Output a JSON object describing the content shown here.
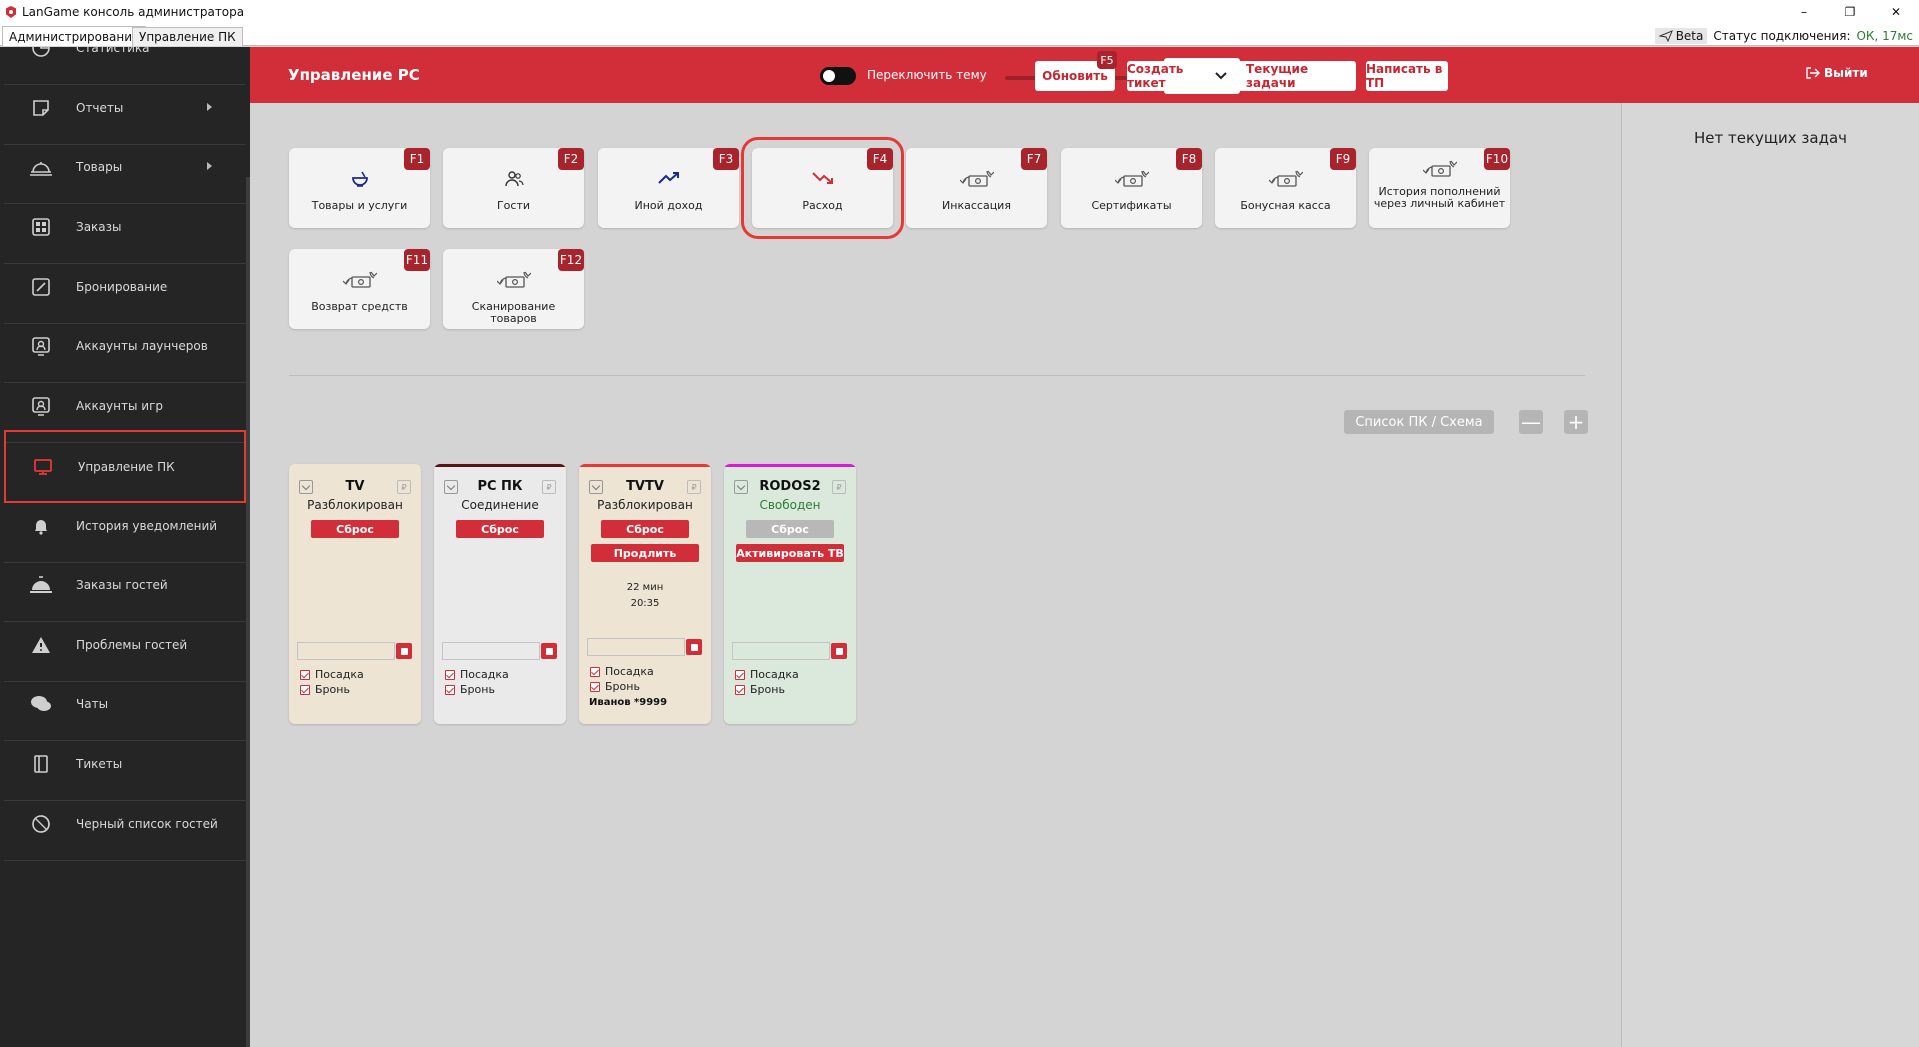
{
  "window": {
    "title": "LanGame консоль администратора",
    "controls": {
      "minimize": "–",
      "maximize": "❐",
      "close": "✕"
    }
  },
  "app_tabs": [
    {
      "label": "Администрирование",
      "active": true
    },
    {
      "label": "Управление ПК",
      "active": false
    }
  ],
  "status": {
    "beta": "Beta",
    "connection_label": "Статус подключения:",
    "connection_value": "ОК, 17мс"
  },
  "sidebar": {
    "items": [
      {
        "label": "Статистика",
        "icon": "chart-pie-icon",
        "submenu": false,
        "active": false
      },
      {
        "label": "Отчеты",
        "icon": "document-icon",
        "submenu": true,
        "active": false
      },
      {
        "label": "Товары",
        "icon": "cloche-icon",
        "submenu": true,
        "active": false
      },
      {
        "label": "Заказы",
        "icon": "grid-icon",
        "submenu": false,
        "active": false
      },
      {
        "label": "Бронирование",
        "icon": "edit-icon",
        "submenu": false,
        "active": false
      },
      {
        "label": "Аккаунты лаунчеров",
        "icon": "account-card-icon",
        "submenu": false,
        "active": false
      },
      {
        "label": "Аккаунты игр",
        "icon": "account-card-icon",
        "submenu": false,
        "active": false
      },
      {
        "label": "Управление ПК",
        "icon": "monitor-icon",
        "submenu": false,
        "active": true
      },
      {
        "label": "История уведомлений",
        "icon": "bell-icon",
        "submenu": false,
        "active": false
      },
      {
        "label": "Заказы гостей",
        "icon": "service-bell-icon",
        "submenu": false,
        "active": false
      },
      {
        "label": "Проблемы гостей",
        "icon": "warning-icon",
        "submenu": false,
        "active": false
      },
      {
        "label": "Чаты",
        "icon": "chat-icon",
        "submenu": false,
        "active": false
      },
      {
        "label": "Тикеты",
        "icon": "ticket-icon",
        "submenu": false,
        "active": false
      },
      {
        "label": "Черный список гостей",
        "icon": "blacklist-icon",
        "submenu": false,
        "active": false
      }
    ]
  },
  "header": {
    "title": "Управление PC",
    "theme_toggle_label": "Переключить тему",
    "language": "ru",
    "refresh_label": "Обновить",
    "refresh_key": "F5",
    "create_ticket_label": "Создать тикет",
    "current_tasks_label": "Текущие задачи",
    "write_support_label": "Написать в ТП",
    "logout_label": "Выйти"
  },
  "tasks_panel": {
    "empty_text": "Нет текущих задач"
  },
  "actions": [
    {
      "label": "Товары и услуги",
      "key": "F1",
      "icon": "bowl-icon"
    },
    {
      "label": "Гости",
      "key": "F2",
      "icon": "users-icon"
    },
    {
      "label": "Иной доход",
      "key": "F3",
      "icon": "trend-up-icon"
    },
    {
      "label": "Расход",
      "key": "F4",
      "icon": "trend-down-icon"
    },
    {
      "label": "Инкассация",
      "key": "F7",
      "icon": "money-exchange-icon"
    },
    {
      "label": "Сертификаты",
      "key": "F8",
      "icon": "money-exchange-icon"
    },
    {
      "label": "Бонусная касса",
      "key": "F9",
      "icon": "money-exchange-icon"
    },
    {
      "label": "История пополнений через личный кабинет",
      "key": "F10",
      "icon": "money-exchange-icon"
    },
    {
      "label": "Возврат средств",
      "key": "F11",
      "icon": "money-exchange-icon"
    },
    {
      "label": "Сканирование товаров",
      "key": "F12",
      "icon": "money-exchange-icon"
    }
  ],
  "pc_list": {
    "view_toggle_label": "Список ПК / Схема",
    "zoom_out": "—",
    "zoom_in": "+"
  },
  "pcs": [
    {
      "name": "TV",
      "state": "Разблокирован",
      "state_color": "#222222",
      "bg": "#ede4d3",
      "top_color": "#ede4d3",
      "reset_label": "Сброс",
      "reset_enabled": true,
      "extra_button": "",
      "time_left": "",
      "time_end": "",
      "opt_seat": "Посадка",
      "opt_booking": "Бронь",
      "guest": ""
    },
    {
      "name": "PC ПК",
      "state": "Соединение",
      "state_color": "#222222",
      "bg": "#eaeaea",
      "top_color": "#5a1416",
      "reset_label": "Сброс",
      "reset_enabled": true,
      "extra_button": "",
      "time_left": "",
      "time_end": "",
      "opt_seat": "Посадка",
      "opt_booking": "Бронь",
      "guest": ""
    },
    {
      "name": "TVTV",
      "state": "Разблокирован",
      "state_color": "#222222",
      "bg": "#ede4d3",
      "top_color": "#e53935",
      "reset_label": "Сброс",
      "reset_enabled": true,
      "extra_button": "Продлить",
      "time_left": "22 мин",
      "time_end": "20:35",
      "opt_seat": "Посадка",
      "opt_booking": "Бронь",
      "guest": "Иванов *9999"
    },
    {
      "name": "RODOS2",
      "state": "Свободен",
      "state_color": "#2e7d32",
      "bg": "#dbe8dc",
      "top_color": "#d81bd6",
      "reset_label": "Сброс",
      "reset_enabled": false,
      "extra_button": "Активировать ТВ",
      "time_left": "",
      "time_end": "",
      "opt_seat": "Посадка",
      "opt_booking": "Бронь",
      "guest": ""
    }
  ],
  "colors": {
    "accent": "#d22e3a",
    "sidebar_bg": "#252525",
    "content_bg": "#d4d4d4",
    "active_frame": "#e53935"
  }
}
